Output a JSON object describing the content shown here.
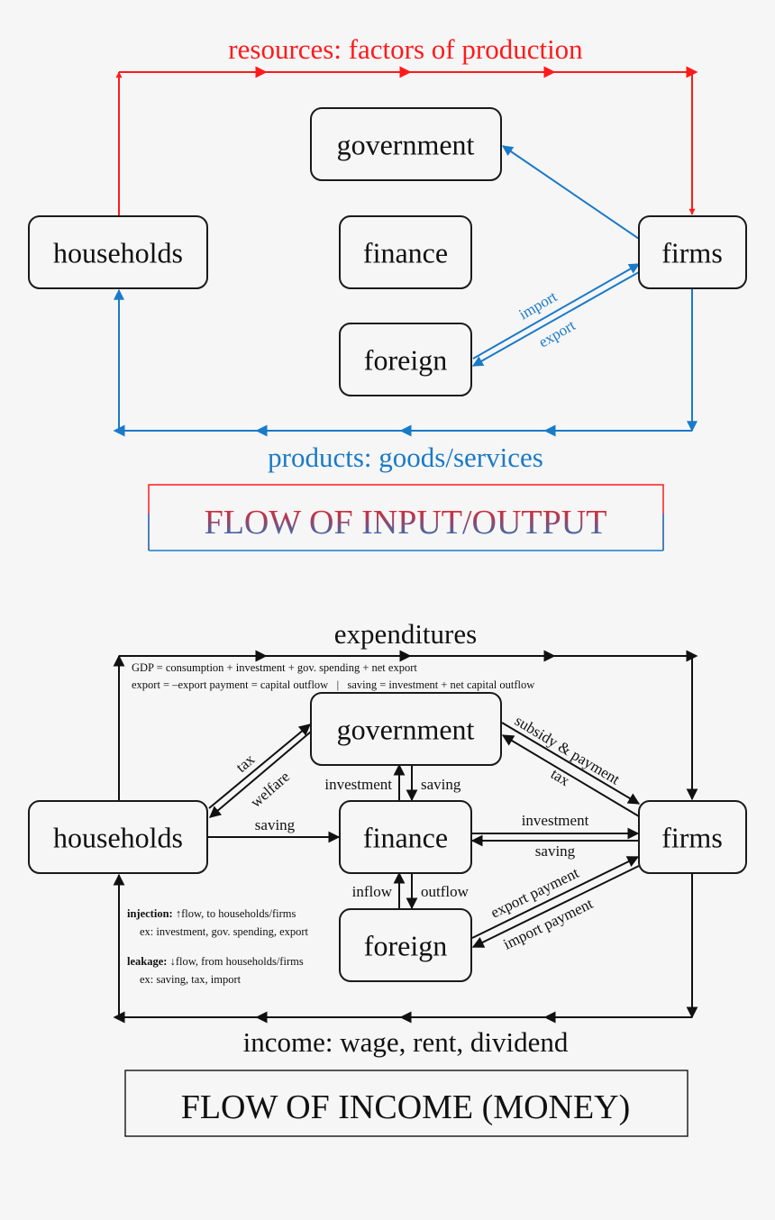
{
  "colors": {
    "background": "#f6f6f6",
    "resource_red": "#ff1a1a",
    "product_blue": "#1a7ac8",
    "money_black": "#111111"
  },
  "diagram_top": {
    "title": "FLOW OF INPUT/OUTPUT",
    "top_flow_label": "resources: factors of production",
    "bottom_flow_label": "products: goods/services",
    "nodes": {
      "households": "households",
      "government": "government",
      "finance": "finance",
      "foreign": "foreign",
      "firms": "firms"
    },
    "edge_labels": {
      "import": "import",
      "export": "export"
    }
  },
  "diagram_bottom": {
    "title": "FLOW OF INCOME (MONEY)",
    "top_flow_label": "expenditures",
    "bottom_flow_label": "income: wage, rent, dividend",
    "formula_1": "GDP = consumption + investment + gov. spending + net export",
    "formula_2": "export = –export payment = capital outflow   |   saving = investment + net capital outflow",
    "nodes": {
      "households": "households",
      "government": "government",
      "finance": "finance",
      "foreign": "foreign",
      "firms": "firms"
    },
    "edge_labels": {
      "tax_household": "tax",
      "welfare": "welfare",
      "saving_household": "saving",
      "investment_gov": "investment",
      "saving_gov": "saving",
      "subsidy_payment": "subsidy & payment",
      "tax_firms": "tax",
      "investment_firms": "investment",
      "saving_firms": "saving",
      "inflow": "inflow",
      "outflow": "outflow",
      "export_payment": "export payment",
      "import_payment": "import payment"
    },
    "notes": {
      "injection_label": "injection:",
      "injection_text": " ↑flow, to households/firms",
      "injection_example": "ex: investment, gov. spending, export",
      "leakage_label": "leakage:",
      "leakage_text": " ↓flow, from households/firms",
      "leakage_example": "ex: saving, tax, import"
    }
  }
}
